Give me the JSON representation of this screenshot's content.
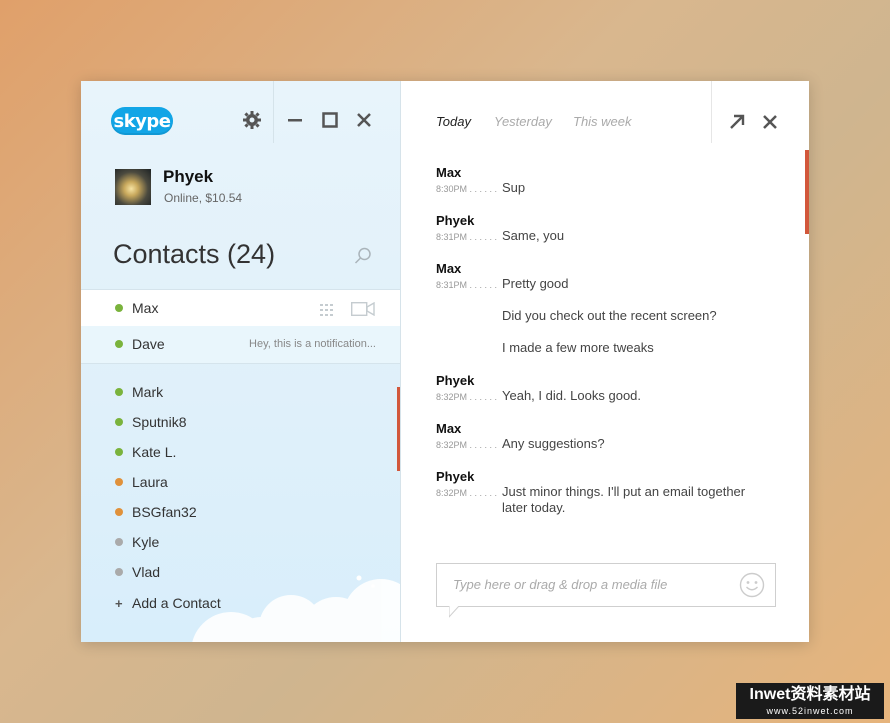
{
  "app": {
    "logo_text": "skype"
  },
  "profile": {
    "name": "Phyek",
    "status": "Online, $10.54"
  },
  "contacts": {
    "title": "Contacts (24)",
    "selected": {
      "name": "Max",
      "status_color": "#7ab33c"
    },
    "notification": {
      "name": "Dave",
      "status_color": "#7ab33c",
      "text": "Hey, this is a notification..."
    },
    "list": [
      {
        "name": "Mark",
        "status_color": "#7ab33c"
      },
      {
        "name": "Sputnik8",
        "status_color": "#7ab33c"
      },
      {
        "name": "Kate L.",
        "status_color": "#7ab33c"
      },
      {
        "name": "Laura",
        "status_color": "#e0913a"
      },
      {
        "name": "BSGfan32",
        "status_color": "#e0913a"
      },
      {
        "name": "Kyle",
        "status_color": "#aaaaaa"
      },
      {
        "name": "Vlad",
        "status_color": "#aaaaaa"
      }
    ],
    "add_label": "Add a Contact"
  },
  "chat": {
    "tabs": [
      "Today",
      "Yesterday",
      "This week"
    ],
    "messages": [
      {
        "sender": "Max",
        "time": "8:30PM",
        "text": "Sup"
      },
      {
        "sender": "Phyek",
        "time": "8:31PM",
        "text": "Same, you"
      },
      {
        "sender": "Max",
        "time": "8:31PM",
        "text": "Pretty good"
      },
      {
        "sender": "",
        "time": "",
        "text": "Did you check out the recent screen?"
      },
      {
        "sender": "",
        "time": "",
        "text": "I made a few more tweaks"
      },
      {
        "sender": "Phyek",
        "time": "8:32PM",
        "text": "Yeah, I did. Looks good."
      },
      {
        "sender": "Max",
        "time": "8:32PM",
        "text": "Any suggestions?"
      },
      {
        "sender": "Phyek",
        "time": "8:32PM",
        "text": "Just minor things. I'll put an email together later today."
      }
    ],
    "input_placeholder": "Type here or drag & drop a media file"
  },
  "watermark": {
    "line1": "Inwet资料素材站",
    "line2": "www.52inwet.com"
  },
  "colors": {
    "accent": "#d2573b",
    "online": "#7ab33c",
    "away": "#e0913a",
    "offline": "#aaaaaa",
    "brand": "#12a5e6"
  }
}
